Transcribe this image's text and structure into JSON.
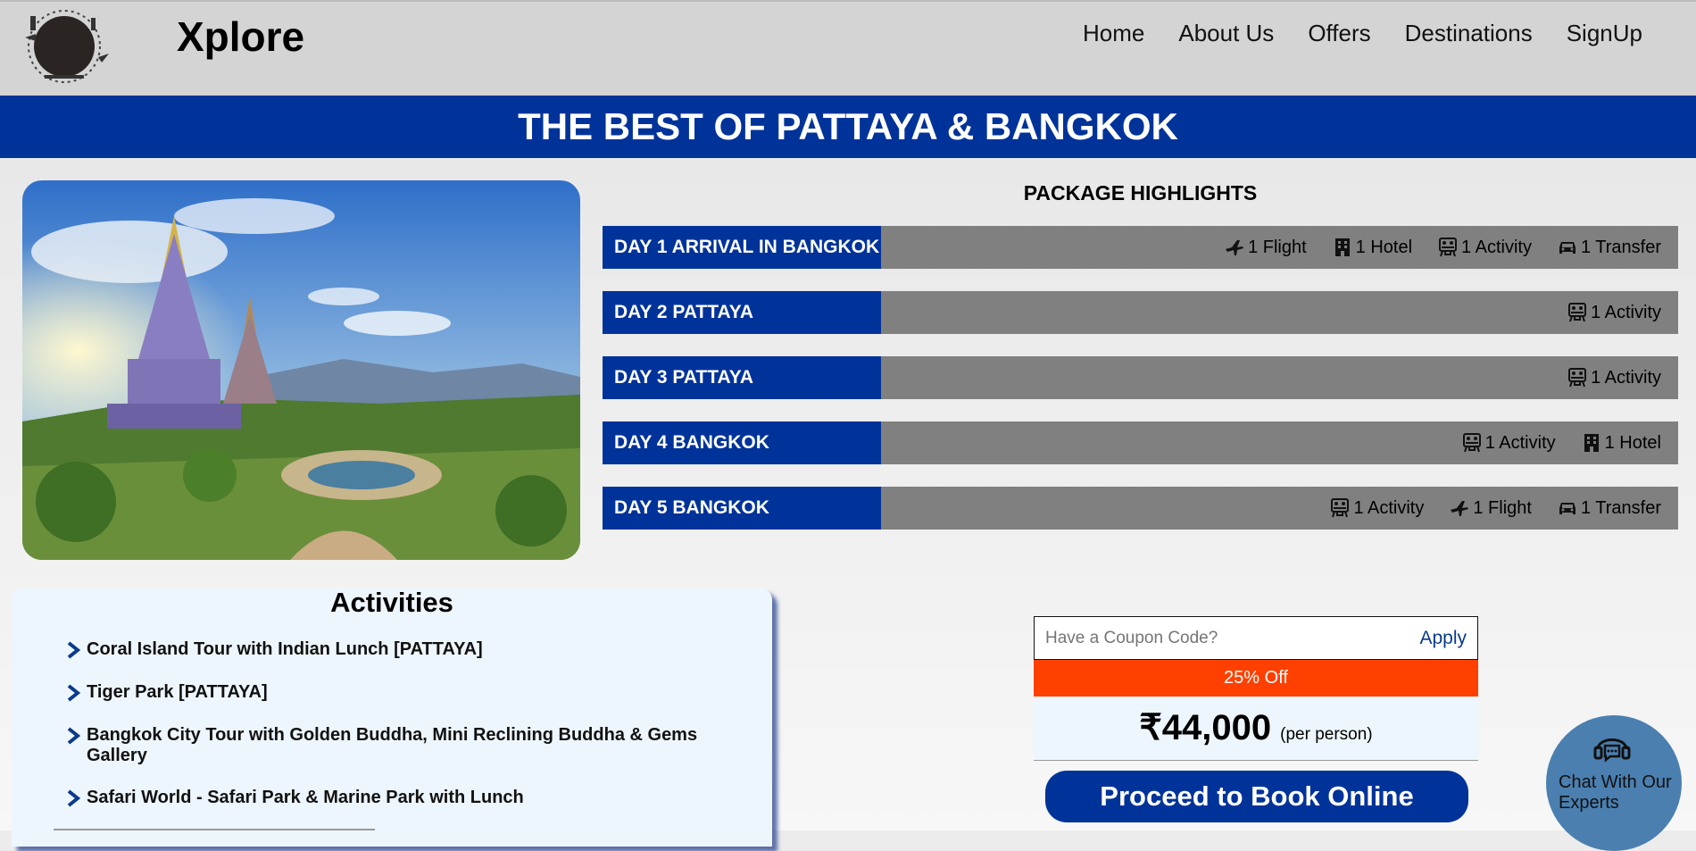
{
  "header": {
    "brand": "Xplore",
    "nav": [
      "Home",
      "About Us",
      "Offers",
      "Destinations",
      "SignUp"
    ]
  },
  "banner": {
    "title": "THE BEST OF PATTAYA & BANGKOK"
  },
  "highlights": {
    "title": "PACKAGE HIGHLIGHTS",
    "days": [
      {
        "label": "DAY 1 ARRIVAL IN BANGKOK",
        "items": [
          {
            "icon": "flight-icon",
            "text": "1 Flight"
          },
          {
            "icon": "hotel-icon",
            "text": "1 Hotel"
          },
          {
            "icon": "activity-icon",
            "text": "1 Activity"
          },
          {
            "icon": "car-icon",
            "text": "1 Transfer"
          }
        ]
      },
      {
        "label": "DAY 2 PATTAYA",
        "items": [
          {
            "icon": "activity-icon",
            "text": "1 Activity"
          }
        ]
      },
      {
        "label": "DAY 3 PATTAYA",
        "items": [
          {
            "icon": "activity-icon",
            "text": "1 Activity"
          }
        ]
      },
      {
        "label": "DAY 4 BANGKOK",
        "items": [
          {
            "icon": "activity-icon",
            "text": "1 Activity"
          },
          {
            "icon": "hotel-icon",
            "text": "1 Hotel"
          }
        ]
      },
      {
        "label": "DAY 5 BANGKOK",
        "items": [
          {
            "icon": "activity-icon",
            "text": "1 Activity"
          },
          {
            "icon": "flight-icon",
            "text": "1 Flight"
          },
          {
            "icon": "car-icon",
            "text": "1 Transfer"
          }
        ]
      }
    ]
  },
  "activities": {
    "title": "Activities",
    "items": [
      "Coral Island Tour with Indian Lunch [PATTAYA]",
      "Tiger Park [PATTAYA]",
      "Bangkok City Tour with Golden Buddha, Mini Reclining Buddha & Gems Gallery",
      "Safari World - Safari Park & Marine Park with Lunch"
    ]
  },
  "booking": {
    "coupon_placeholder": "Have a Coupon Code?",
    "apply": "Apply",
    "discount": "25% Off",
    "price": "₹44,000",
    "per": "(per person)",
    "book": "Proceed to Book Online"
  },
  "chat": {
    "label": "Chat With Our Experts"
  },
  "colors": {
    "primary": "#003399",
    "discount": "#ff4000",
    "row_bg": "#808080",
    "chat": "#4a7fb0"
  }
}
